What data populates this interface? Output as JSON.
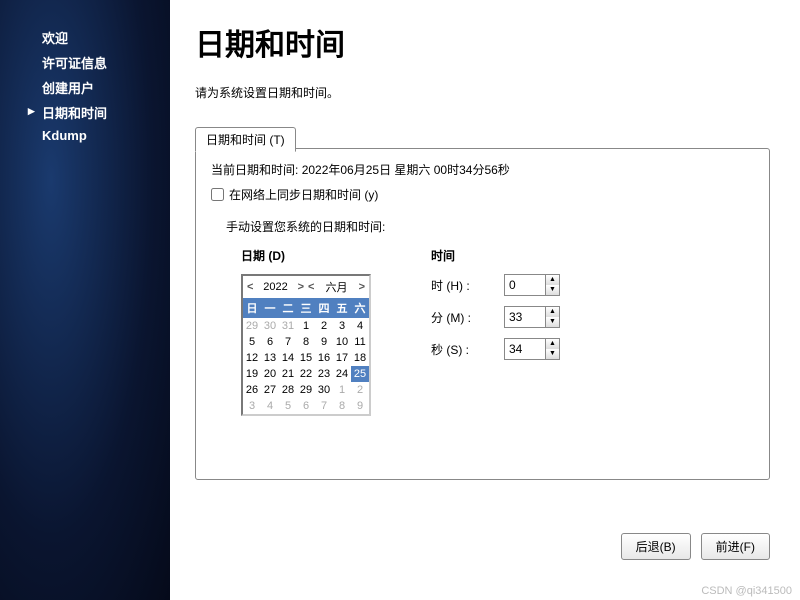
{
  "sidebar": {
    "items": [
      {
        "label": "欢迎"
      },
      {
        "label": "许可证信息"
      },
      {
        "label": "创建用户"
      },
      {
        "label": "日期和时间"
      },
      {
        "label": "Kdump"
      }
    ]
  },
  "main": {
    "title": "日期和时间",
    "instruction": "请为系统设置日期和时间。",
    "tab_label": "日期和时间 (T)",
    "current_label": "当前日期和时间:",
    "current_value": "2022年06月25日 星期六 00时34分56秒",
    "sync_label": "在网络上同步日期和时间 (y)",
    "manual_label": "手动设置您系统的日期和时间:",
    "date_label": "日期 (D)",
    "time_label": "时间",
    "cal": {
      "year": "2022",
      "month": "六月",
      "dow": [
        "日",
        "一",
        "二",
        "三",
        "四",
        "五",
        "六"
      ],
      "days": [
        {
          "n": "29",
          "o": true
        },
        {
          "n": "30",
          "o": true
        },
        {
          "n": "31",
          "o": true
        },
        {
          "n": "1"
        },
        {
          "n": "2"
        },
        {
          "n": "3"
        },
        {
          "n": "4"
        },
        {
          "n": "5"
        },
        {
          "n": "6"
        },
        {
          "n": "7"
        },
        {
          "n": "8"
        },
        {
          "n": "9"
        },
        {
          "n": "10"
        },
        {
          "n": "11"
        },
        {
          "n": "12"
        },
        {
          "n": "13"
        },
        {
          "n": "14"
        },
        {
          "n": "15"
        },
        {
          "n": "16"
        },
        {
          "n": "17"
        },
        {
          "n": "18"
        },
        {
          "n": "19"
        },
        {
          "n": "20"
        },
        {
          "n": "21"
        },
        {
          "n": "22"
        },
        {
          "n": "23"
        },
        {
          "n": "24"
        },
        {
          "n": "25",
          "sel": true
        },
        {
          "n": "26"
        },
        {
          "n": "27"
        },
        {
          "n": "28"
        },
        {
          "n": "29"
        },
        {
          "n": "30"
        },
        {
          "n": "1",
          "o": true
        },
        {
          "n": "2",
          "o": true
        },
        {
          "n": "3",
          "o": true
        },
        {
          "n": "4",
          "o": true
        },
        {
          "n": "5",
          "o": true
        },
        {
          "n": "6",
          "o": true
        },
        {
          "n": "7",
          "o": true
        },
        {
          "n": "8",
          "o": true
        },
        {
          "n": "9",
          "o": true
        }
      ]
    },
    "time": {
      "hour_label": "时 (H) :",
      "min_label": "分 (M) :",
      "sec_label": "秒 (S) :",
      "hour": "0",
      "min": "33",
      "sec": "34"
    },
    "back_btn": "后退(B)",
    "fwd_btn": "前进(F)"
  },
  "watermark": "CSDN @qi341500"
}
